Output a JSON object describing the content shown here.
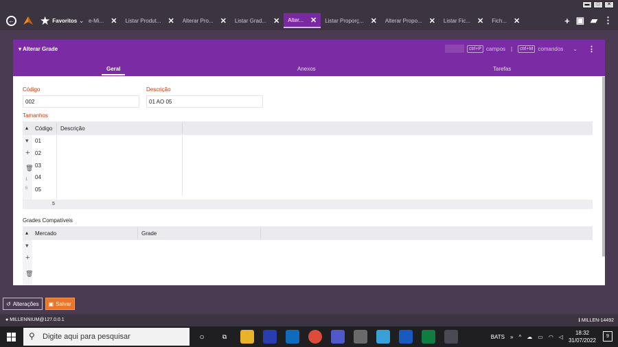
{
  "topbar": {
    "favorites_label": "Favoritos",
    "tabs": [
      {
        "label": "e-Mi..."
      },
      {
        "label": "Listar Produt..."
      },
      {
        "label": "Alterar Pro..."
      },
      {
        "label": "Listar Grad..."
      },
      {
        "label": "Alter...",
        "active": true
      },
      {
        "label": "Listar Proporç..."
      },
      {
        "label": "Alterar Propo..."
      },
      {
        "label": "Listar Fic..."
      },
      {
        "label": "Fich..."
      }
    ]
  },
  "panel": {
    "title": "Alterar Grade",
    "shortcut_fields_key": "ctrl+P",
    "shortcut_fields_label": "campos",
    "separator": "|",
    "shortcut_commands_key": "ctrl+M",
    "shortcut_commands_label": "comandos",
    "tabs": [
      "Geral",
      "Anexos",
      "Tarefas"
    ]
  },
  "form": {
    "codigo_label": "Código",
    "codigo_value": "002",
    "descricao_label": "Descrição",
    "descricao_value": "01 AO 05"
  },
  "tamanhos": {
    "section_label": "Tamanhos",
    "columns": [
      "Código",
      "Descrição"
    ],
    "rows": [
      "01",
      "02",
      "03",
      "04",
      "05"
    ],
    "pager_current": "1",
    "pager_total": "5",
    "footer_count": "5"
  },
  "grades": {
    "section_label": "Grades Compatíveis",
    "columns": [
      "Mercado",
      "Grade"
    ]
  },
  "actions": {
    "alteracoes": "Alterações",
    "salvar": "Salvar"
  },
  "status": {
    "user": "MILLENNIUM@127.0.0.1",
    "version": "MILLEN-14492"
  },
  "taskbar": {
    "search_placeholder": "Digite aqui para pesquisar",
    "bats": "BATS",
    "chevron": "»",
    "time": "18:32",
    "date": "31/07/2022",
    "notifications": "9"
  },
  "colors": {
    "accent": "#7b2ba3",
    "label": "#c23a10",
    "save": "#e9752a"
  }
}
